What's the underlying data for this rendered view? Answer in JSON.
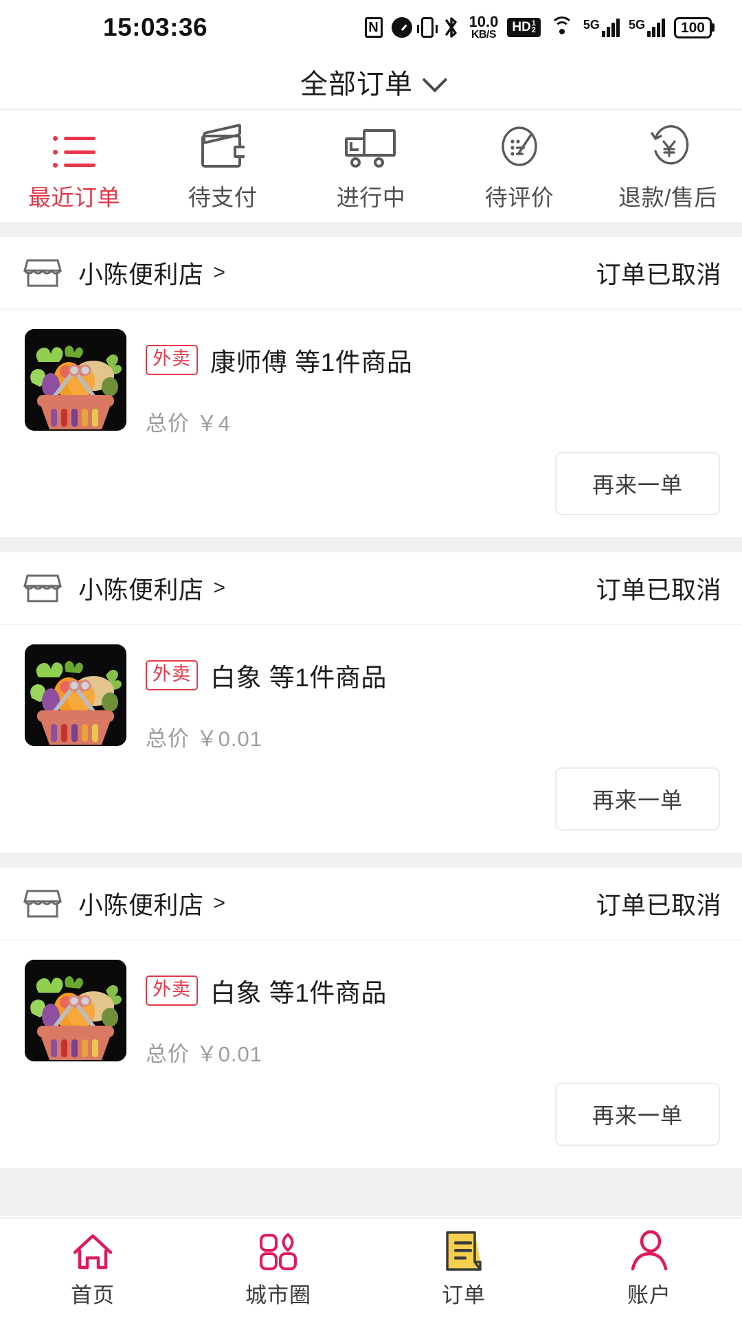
{
  "status_bar": {
    "time": "15:03:36",
    "icons": [
      {
        "name": "nfc-icon",
        "glyph": "N"
      },
      {
        "name": "alarm-icon",
        "glyph": ""
      },
      {
        "name": "vibrate-icon",
        "glyph": ""
      },
      {
        "name": "bluetooth-icon",
        "glyph": "✱"
      },
      {
        "name": "network-speed-icon",
        "value": "10.0",
        "unit": "KB/S"
      },
      {
        "name": "hd-voice-icon",
        "glyph": "HD"
      },
      {
        "name": "wifi-icon",
        "glyph": ""
      },
      {
        "name": "signal-5g-1-icon",
        "label": "5G"
      },
      {
        "name": "signal-5g-2-icon",
        "label": "5G"
      },
      {
        "name": "battery-icon",
        "level": "100"
      }
    ],
    "network_speed": "10.0",
    "network_speed_unit": "KB/S",
    "hd_label": "HD",
    "signal_label_1": "5G",
    "signal_label_2": "5G",
    "battery_level": "100",
    "nfc_label": "N"
  },
  "header": {
    "title": "全部订单",
    "dropdown_icon": "chevron-down-icon"
  },
  "category_tabs": [
    {
      "label": "最近订单",
      "icon": "list-icon",
      "active": true
    },
    {
      "label": "待支付",
      "icon": "wallet-icon",
      "active": false
    },
    {
      "label": "进行中",
      "icon": "truck-icon",
      "active": false
    },
    {
      "label": "待评价",
      "icon": "review-icon",
      "active": false
    },
    {
      "label": "退款/售后",
      "icon": "refund-icon",
      "active": false
    }
  ],
  "orders": [
    {
      "shop_name": "小陈便利店",
      "shop_arrow": ">",
      "status": "订单已取消",
      "badge": "外卖",
      "product_title": "康师傅 等1件商品",
      "price_label": "总价",
      "price_value": "￥4",
      "action_label": "再来一单",
      "thumbnail": "grocery-basket-image"
    },
    {
      "shop_name": "小陈便利店",
      "shop_arrow": ">",
      "status": "订单已取消",
      "badge": "外卖",
      "product_title": "白象 等1件商品",
      "price_label": "总价",
      "price_value": "￥0.01",
      "action_label": "再来一单",
      "thumbnail": "grocery-basket-image"
    },
    {
      "shop_name": "小陈便利店",
      "shop_arrow": ">",
      "status": "订单已取消",
      "badge": "外卖",
      "product_title": "白象 等1件商品",
      "price_label": "总价",
      "price_value": "￥0.01",
      "action_label": "再来一单",
      "thumbnail": "grocery-basket-image"
    }
  ],
  "bottom_nav": [
    {
      "label": "首页",
      "icon": "home-icon",
      "active": false
    },
    {
      "label": "城市圈",
      "icon": "city-circle-icon",
      "active": false
    },
    {
      "label": "订单",
      "icon": "order-document-icon",
      "active": true
    },
    {
      "label": "账户",
      "icon": "account-person-icon",
      "active": false
    }
  ],
  "colors": {
    "accent_red": "#e8374a",
    "accent_pink": "#e2185f",
    "order_active_yellow": "#f5d04e",
    "text_primary": "#1d1d1d",
    "text_secondary": "#9d9d9d",
    "divider": "#f1f1f1"
  }
}
